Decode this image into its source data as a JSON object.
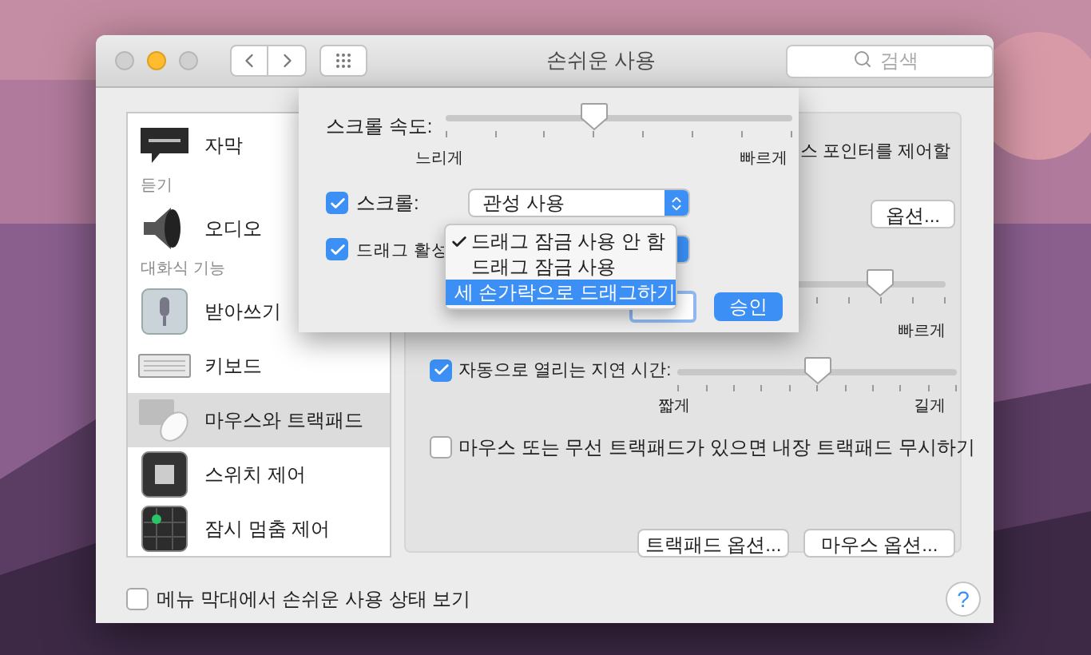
{
  "window": {
    "title": "손쉬운 사용",
    "search": {
      "placeholder": "검색"
    }
  },
  "sidebar": {
    "items": [
      {
        "kind": "item",
        "label": "자막",
        "selected": false
      },
      {
        "kind": "header",
        "label": "듣기"
      },
      {
        "kind": "item",
        "label": "오디오",
        "selected": false
      },
      {
        "kind": "header",
        "label": "대화식 기능"
      },
      {
        "kind": "item",
        "label": "받아쓰기",
        "selected": false
      },
      {
        "kind": "item",
        "label": "키보드",
        "selected": false
      },
      {
        "kind": "item",
        "label": "마우스와 트랙패드",
        "selected": true
      },
      {
        "kind": "item",
        "label": "스위치 제어",
        "selected": false
      },
      {
        "kind": "item",
        "label": "잠시 멈춤 제어",
        "selected": false
      }
    ]
  },
  "panel": {
    "description": "스 포인터를 제어할",
    "options_button": "옵션...",
    "speed_slider": {
      "level": 0.77,
      "max_label": "빠르게"
    },
    "delay": {
      "label": "자동으로 열리는 지연 시간:",
      "checked": true,
      "level": 0.5,
      "min_label": "짧게",
      "max_label": "길게"
    },
    "ignore_trackpad": {
      "label": "마우스 또는 무선 트랙패드가 있으면 내장 트랙패드 무시하기",
      "checked": false
    },
    "buttons": [
      "트랙패드 옵션...",
      "마우스 옵션..."
    ]
  },
  "sheet": {
    "speed": {
      "label": "스크롤 속도:",
      "level": 0.43,
      "min_label": "느리게",
      "max_label": "빠르게"
    },
    "scroll": {
      "label": "스크롤:",
      "checked": true,
      "value": "관성 사용"
    },
    "drag": {
      "label": "드래그 활성",
      "checked": true
    },
    "menu": [
      {
        "label": "드래그 잠금 사용 안 함",
        "checked": true,
        "selected": false
      },
      {
        "label": "드래그 잠금 사용",
        "checked": false,
        "selected": false
      },
      {
        "label": "세 손가락으로 드래그하기",
        "checked": false,
        "selected": true
      }
    ],
    "ok_button": "승인"
  },
  "menu_bar_status": {
    "label": "메뉴 막대에서 손쉬운 사용 상태 보기",
    "checked": false
  },
  "help": "?"
}
